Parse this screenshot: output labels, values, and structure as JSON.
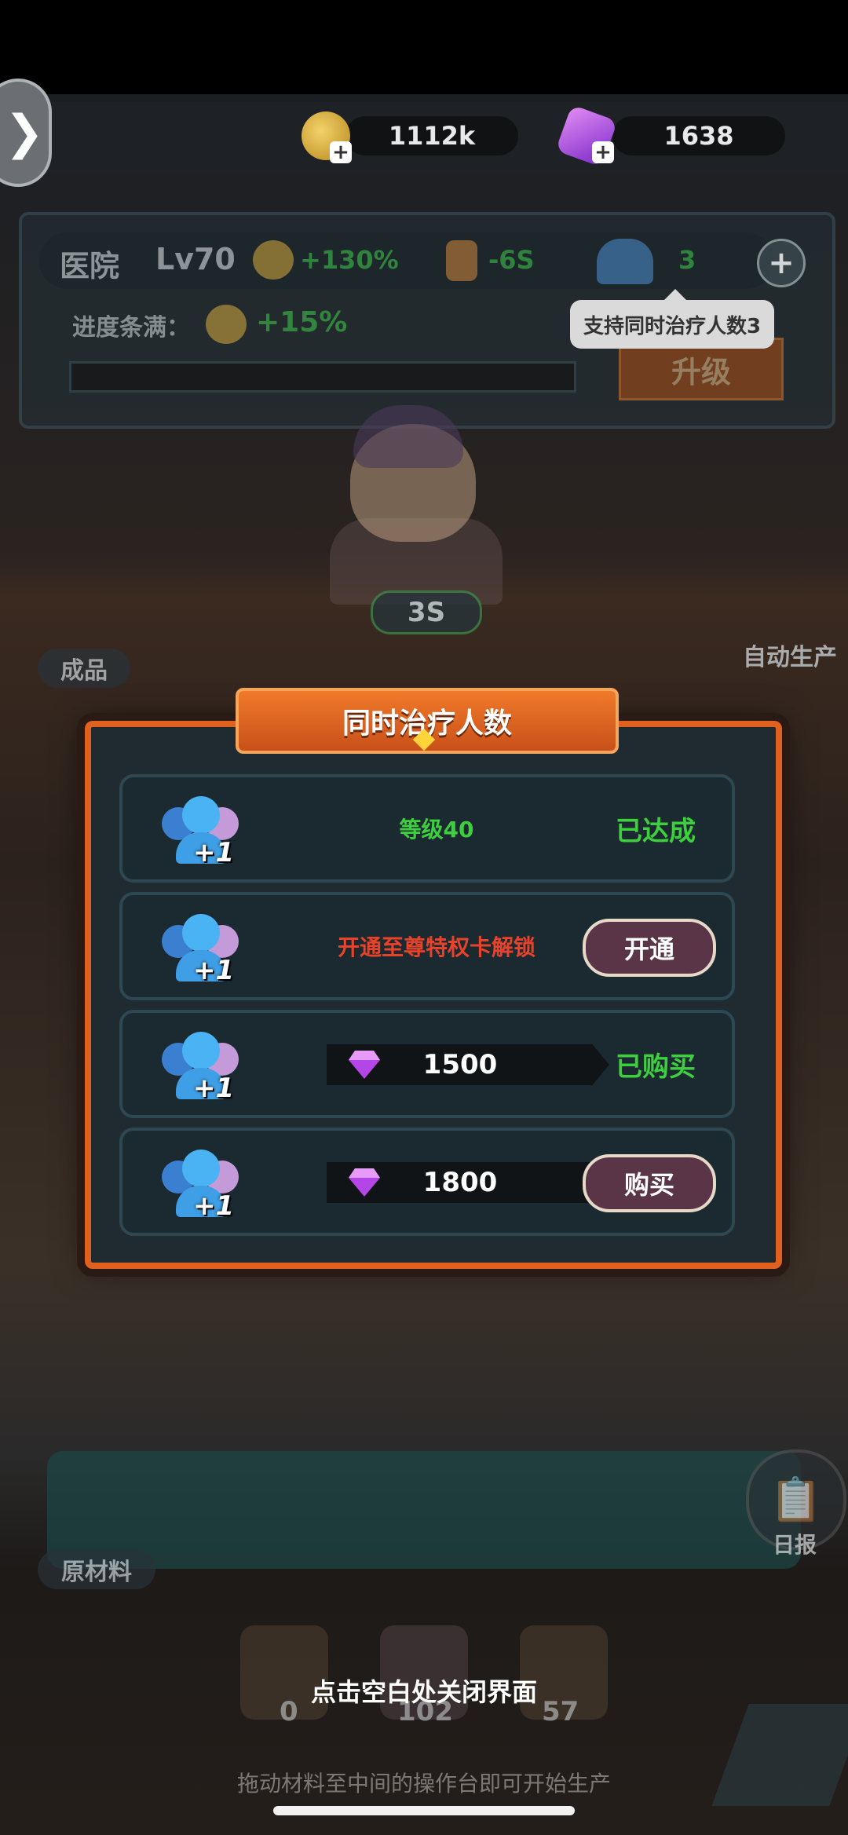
{
  "resources": {
    "gold": "1112k",
    "gems": "1638"
  },
  "building": {
    "name": "医院",
    "level": "Lv70",
    "gold_bonus": "+130%",
    "time_bonus": "-6S",
    "patients": "3",
    "progress_label": "进度条满：",
    "progress_bonus": "+15%",
    "tooltip": "支持同时治疗人数3",
    "upgrade_label": "升级",
    "timer": "3S"
  },
  "scene": {
    "products_label": "成品",
    "auto_produce_label": "自动生产",
    "materials_label": "原材料",
    "daily_report_label": "日报",
    "material_counts": [
      "0",
      "102",
      "57"
    ],
    "drag_hint": "拖动材料至中间的操作台即可开始生产",
    "close_hint": "点击空白处关闭界面"
  },
  "dialog": {
    "title": "同时治疗人数",
    "plus_one": "+1",
    "rows": [
      {
        "condition": "等级40",
        "status": "已达成"
      },
      {
        "condition": "开通至尊特权卡解锁",
        "button": "开通"
      },
      {
        "price": "1500",
        "status": "已购买"
      },
      {
        "price": "1800",
        "button": "购买"
      }
    ]
  },
  "colors": {
    "accent_orange": "#e0611f",
    "success_green": "#3ecf3e",
    "locked_red": "#e8432a",
    "button_purple": "#5a3548"
  }
}
